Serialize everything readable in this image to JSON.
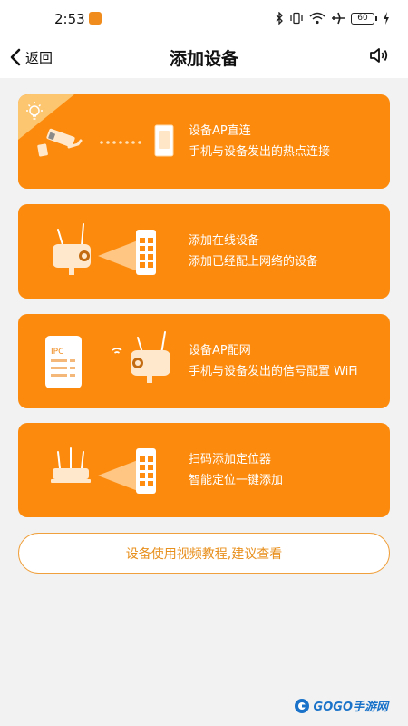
{
  "status_bar": {
    "time": "2:53",
    "battery": "60"
  },
  "nav": {
    "back_label": "返回",
    "title": "添加设备"
  },
  "cards": [
    {
      "title": "设备AP直连",
      "desc": "手机与设备发出的热点连接"
    },
    {
      "title": "添加在线设备",
      "desc": "添加已经配上网络的设备"
    },
    {
      "title": "设备AP配网",
      "desc": "手机与设备发出的信号配置 WiFi"
    },
    {
      "title": "扫码添加定位器",
      "desc": "智能定位一键添加"
    }
  ],
  "ipc_label": "IPC",
  "tutorial_button": "设备使用视频教程,建议查看",
  "watermark": "GOGO手游网",
  "colors": {
    "card_orange": "#fb8a0d",
    "accent_text": "#e8901e",
    "background": "#f2f2f2"
  }
}
